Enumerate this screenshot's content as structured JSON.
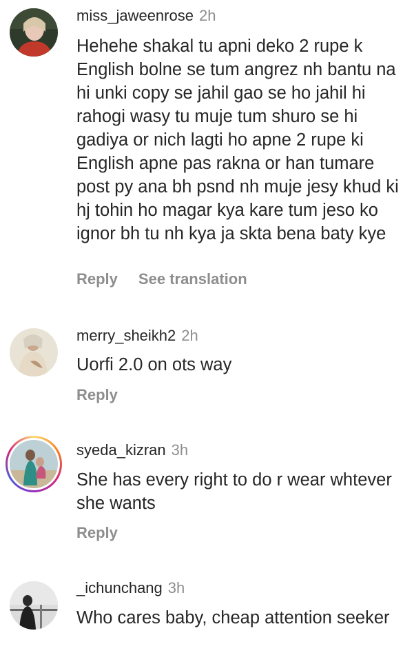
{
  "comments": [
    {
      "username": "miss_jaweenrose",
      "time": "2h",
      "avatar_icon": "avatar-photo",
      "has_story_ring": false,
      "text": "Hehehe shakal tu apni deko 2 rupe k English bolne se tum angrez nh bantu na hi unki copy se jahil gao se ho jahil hi rahogi wasy tu muje tum shuro se hi gadiya or nich lagti ho apne 2 rupe ki English apne pas rakna or han tumare post py ana bh psnd nh muje jesy khud ki hj tohin ho magar kya kare tum jeso ko ignor bh tu nh kya ja skta bena baty kye",
      "reply_label": "Reply",
      "translate_label": "See translation"
    },
    {
      "username": "merry_sheikh2",
      "time": "2h",
      "avatar_icon": "avatar-photo",
      "has_story_ring": false,
      "text": "Uorfi 2.0 on ots way",
      "reply_label": "Reply"
    },
    {
      "username": "syeda_kizran",
      "time": "3h",
      "avatar_icon": "avatar-photo",
      "has_story_ring": true,
      "text": "She has every right to do r wear whtever she wants",
      "reply_label": "Reply"
    },
    {
      "username": "_ichunchang",
      "time": "3h",
      "avatar_icon": "avatar-photo",
      "has_story_ring": false,
      "text": "Who cares baby, cheap attention seeker"
    }
  ],
  "colors": {
    "text": "#262626",
    "secondary": "#8e8e8e",
    "background": "#ffffff"
  }
}
